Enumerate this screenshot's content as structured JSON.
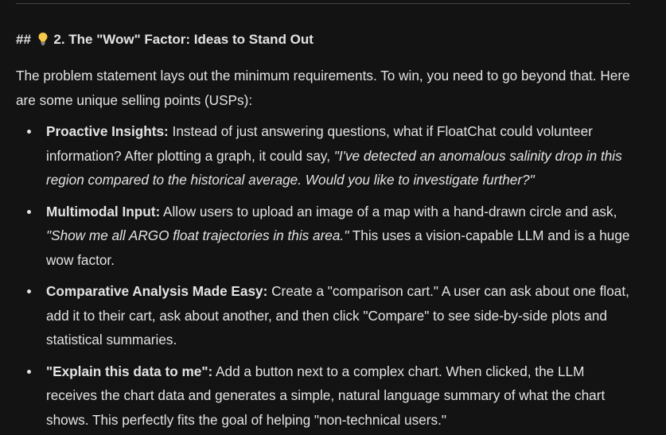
{
  "heading": {
    "prefix": "##",
    "icon": "lightbulb-icon",
    "text": "2. The \"Wow\" Factor: Ideas to Stand Out"
  },
  "intro": "The problem statement lays out the minimum requirements. To win, you need to go beyond that. Here are some unique selling points (USPs):",
  "usps": [
    {
      "title": "Proactive Insights:",
      "pre": " Instead of just answering questions, what if FloatChat could volunteer information? After plotting a graph, it could say, ",
      "quote": "\"I've detected an anomalous salinity drop in this region compared to the historical average. Would you like to investigate further?\"",
      "post": ""
    },
    {
      "title": "Multimodal Input:",
      "pre": " Allow users to upload an image of a map with a hand-drawn circle and ask, ",
      "quote": "\"Show me all ARGO float trajectories in this area.\"",
      "post": " This uses a vision-capable LLM and is a huge wow factor."
    },
    {
      "title": "Comparative Analysis Made Easy:",
      "pre": " Create a \"comparison cart.\" A user can ask about one float, add it to their cart, ask about another, and then click \"Compare\" to see side-by-side plots and statistical summaries.",
      "quote": "",
      "post": ""
    },
    {
      "title": "\"Explain this data to me\":",
      "pre": " Add a button next to a complex chart. When clicked, the LLM receives the chart data and generates a simple, natural language summary of what the chart shows. This perfectly fits the goal of helping \"non-technical users.\"",
      "quote": "",
      "post": ""
    }
  ],
  "colors": {
    "background": "#131314",
    "text": "#e3e3e3",
    "divider": "#444746",
    "bulb": "#f6c94a"
  }
}
